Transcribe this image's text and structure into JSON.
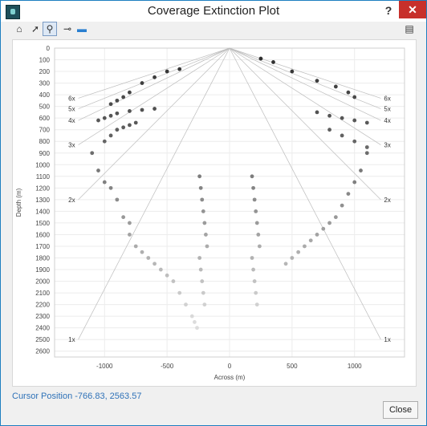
{
  "window": {
    "title": "Coverage Extinction Plot",
    "help_label": "?",
    "close_glyph": "✕"
  },
  "toolbar": [
    {
      "name": "home-icon",
      "glyph": "⌂"
    },
    {
      "name": "pointer-icon",
      "glyph": "➚"
    },
    {
      "name": "zoom-icon",
      "glyph": "⚲",
      "selected": true
    },
    {
      "name": "wellpath-icon",
      "glyph": "⊸"
    },
    {
      "name": "colormap-icon",
      "glyph": "▬"
    }
  ],
  "toolbar_right": {
    "name": "export-icon",
    "glyph": "▤"
  },
  "cursor": {
    "label": "Cursor Position",
    "value": "-766.83, 2563.57"
  },
  "buttons": {
    "close": "Close"
  },
  "chart_data": {
    "type": "scatter",
    "xlabel": "Across (m)",
    "ylabel": "Depth (m)",
    "xlim": [
      -1400,
      1400
    ],
    "ylim": [
      0,
      2650
    ],
    "yreversed": true,
    "x_ticks": [
      -1000,
      -500,
      0,
      500,
      1000
    ],
    "y_ticks": [
      0,
      100,
      200,
      300,
      400,
      500,
      600,
      700,
      800,
      900,
      1000,
      1100,
      1200,
      1300,
      1400,
      1500,
      1600,
      1700,
      1800,
      1900,
      2000,
      2100,
      2200,
      2300,
      2400,
      2500,
      2600
    ],
    "grid": true,
    "coverage_lines": [
      {
        "label": "6x",
        "ratio": 6
      },
      {
        "label": "5x",
        "ratio": 5
      },
      {
        "label": "4x",
        "ratio": 4
      },
      {
        "label": "3x",
        "ratio": 3
      },
      {
        "label": "2x",
        "ratio": 2
      },
      {
        "label": "1x",
        "ratio": 1
      }
    ],
    "series": [
      {
        "x": [
          -950,
          -900,
          -850,
          -800,
          -700,
          -600,
          -500,
          -400
        ],
        "y": [
          480,
          450,
          420,
          380,
          300,
          250,
          200,
          180
        ]
      },
      {
        "x": [
          -1050,
          -1000,
          -950,
          -900,
          -800,
          -700,
          -600
        ],
        "y": [
          620,
          600,
          580,
          560,
          540,
          530,
          520
        ]
      },
      {
        "x": [
          -1000,
          -950,
          -900,
          -850,
          -800,
          -750
        ],
        "y": [
          800,
          750,
          700,
          680,
          660,
          640
        ]
      },
      {
        "x": [
          -1100,
          -1050,
          -1000,
          -950,
          -900,
          -850,
          -800
        ],
        "y": [
          900,
          1050,
          1150,
          1200,
          1300,
          1450,
          1500
        ]
      },
      {
        "x": [
          -800,
          -750,
          -700,
          -650,
          -600,
          -550,
          -500
        ],
        "y": [
          1600,
          1700,
          1750,
          1800,
          1850,
          1900,
          1950
        ]
      },
      {
        "x": [
          -450,
          -400,
          -350,
          -300,
          -280,
          -260
        ],
        "y": [
          2000,
          2100,
          2200,
          2300,
          2350,
          2400
        ]
      },
      {
        "x": [
          -240,
          -230,
          -220,
          -210,
          -200,
          -190,
          -180
        ],
        "y": [
          1100,
          1200,
          1300,
          1400,
          1500,
          1600,
          1700
        ]
      },
      {
        "x": [
          -240,
          -230,
          -220,
          -210,
          -200
        ],
        "y": [
          1800,
          1900,
          2000,
          2100,
          2200
        ]
      },
      {
        "x": [
          180,
          190,
          200,
          210,
          220,
          230,
          240
        ],
        "y": [
          1100,
          1200,
          1300,
          1400,
          1500,
          1600,
          1700
        ]
      },
      {
        "x": [
          180,
          190,
          200,
          210,
          220
        ],
        "y": [
          1800,
          1900,
          2000,
          2100,
          2200
        ]
      },
      {
        "x": [
          250,
          350,
          500,
          700,
          850,
          950,
          1000
        ],
        "y": [
          90,
          120,
          200,
          280,
          330,
          380,
          420
        ]
      },
      {
        "x": [
          700,
          800,
          900,
          1000,
          1100
        ],
        "y": [
          550,
          580,
          600,
          620,
          640
        ]
      },
      {
        "x": [
          800,
          900,
          1000,
          1100
        ],
        "y": [
          700,
          750,
          800,
          850
        ]
      },
      {
        "x": [
          1100,
          1050,
          1000,
          950,
          900,
          850,
          800
        ],
        "y": [
          900,
          1050,
          1150,
          1250,
          1350,
          1450,
          1500
        ]
      },
      {
        "x": [
          750,
          700,
          650,
          600,
          550,
          500,
          450
        ],
        "y": [
          1550,
          1600,
          1650,
          1700,
          1750,
          1800,
          1850
        ]
      }
    ]
  }
}
